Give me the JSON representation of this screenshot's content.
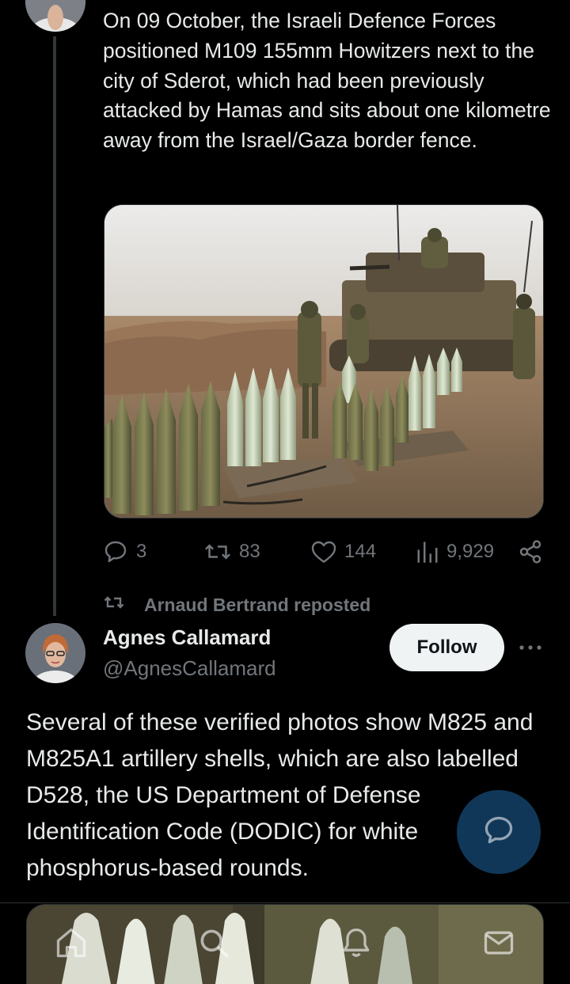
{
  "tweet1": {
    "text": "On 09 October, the Israeli Defence Forces positioned M109 155mm Howitzers next to the city of Sderot, which had been previously attacked by Hamas and sits about one kilometre away from the Israel/Gaza border fence.",
    "media_alt": "soldiers-with-howitzer-and-artillery-shells",
    "stats": {
      "replies": "3",
      "reposts": "83",
      "likes": "144",
      "views": "9,929"
    }
  },
  "repost_banner": {
    "label": "Arnaud Bertrand reposted"
  },
  "tweet2": {
    "name": "Agnes Callamard",
    "handle": "@AgnesCallamard",
    "follow_label": "Follow",
    "text": "Several of these verified photos show M825 and M825A1 artillery shells, which are also labelled D528, the US Department of Defense Identification Code (DODIC) for white phosphorus-based rounds."
  },
  "nav": {
    "items": [
      "home-icon",
      "search-icon",
      "bell-icon",
      "mail-icon"
    ]
  },
  "colors": {
    "background": "#000000",
    "text": "#e7e9ea",
    "muted": "#71767b",
    "follow_bg": "#eff3f4",
    "fab": "#1d64a0"
  }
}
